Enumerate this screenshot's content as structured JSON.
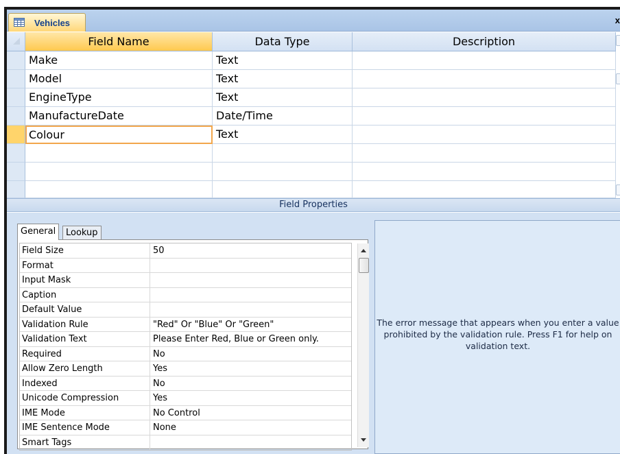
{
  "document_tab": {
    "label": "Vehicles",
    "close": "x"
  },
  "grid": {
    "columns": [
      "Field Name",
      "Data Type",
      "Description"
    ],
    "rows": [
      {
        "field_name": "Make",
        "data_type": "Text",
        "description": ""
      },
      {
        "field_name": "Model",
        "data_type": "Text",
        "description": ""
      },
      {
        "field_name": "EngineType",
        "data_type": "Text",
        "description": ""
      },
      {
        "field_name": "ManufactureDate",
        "data_type": "Date/Time",
        "description": ""
      },
      {
        "field_name": "Colour",
        "data_type": "Text",
        "description": ""
      },
      {
        "field_name": "",
        "data_type": "",
        "description": ""
      },
      {
        "field_name": "",
        "data_type": "",
        "description": ""
      },
      {
        "field_name": "",
        "data_type": "",
        "description": ""
      }
    ],
    "current_row_index": 4
  },
  "field_properties": {
    "title": "Field Properties",
    "tabs": [
      "General",
      "Lookup"
    ],
    "active_tab": "General",
    "properties": [
      {
        "name": "Field Size",
        "value": "50"
      },
      {
        "name": "Format",
        "value": ""
      },
      {
        "name": "Input Mask",
        "value": ""
      },
      {
        "name": "Caption",
        "value": ""
      },
      {
        "name": "Default Value",
        "value": ""
      },
      {
        "name": "Validation Rule",
        "value": "\"Red\" Or \"Blue\" Or \"Green\""
      },
      {
        "name": "Validation Text",
        "value": "Please Enter Red, Blue or Green only."
      },
      {
        "name": "Required",
        "value": "No"
      },
      {
        "name": "Allow Zero Length",
        "value": "Yes"
      },
      {
        "name": "Indexed",
        "value": "No"
      },
      {
        "name": "Unicode Compression",
        "value": "Yes"
      },
      {
        "name": "IME Mode",
        "value": "No Control"
      },
      {
        "name": "IME Sentence Mode",
        "value": "None"
      },
      {
        "name": "Smart Tags",
        "value": ""
      }
    ],
    "help_text": "The error message that appears when you enter a value prohibited by the validation rule. Press F1 for help on validation text."
  },
  "colors": {
    "tab_active": "#ffd778",
    "header_bg": "#d3e1f3",
    "focus_border": "#f2a64c",
    "panel_bg": "#d2e1f3"
  }
}
